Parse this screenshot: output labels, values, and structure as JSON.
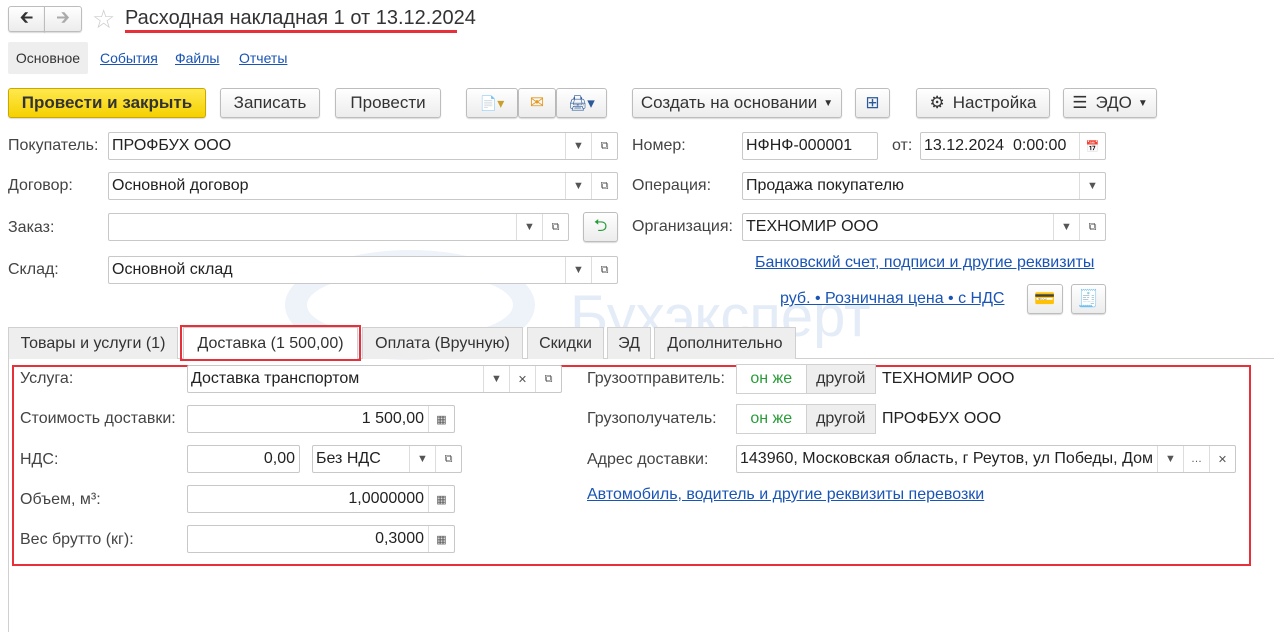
{
  "title": "Расходная накладная 1 от 13.12.2024",
  "nav_tabs": [
    "Основное",
    "События",
    "Файлы",
    "Отчеты"
  ],
  "toolbar": {
    "post_close": "Провести и закрыть",
    "save": "Записать",
    "post": "Провести",
    "create_based": "Создать на основании",
    "settings": "Настройка",
    "edo": "ЭДО"
  },
  "fields": {
    "buyer": {
      "label": "Покупатель:",
      "value": "ПРОФБУХ ООО"
    },
    "contract": {
      "label": "Договор:",
      "value": "Основной договор"
    },
    "order": {
      "label": "Заказ:",
      "value": ""
    },
    "warehouse": {
      "label": "Склад:",
      "value": "Основной склад"
    },
    "number": {
      "label": "Номер:",
      "value": "НФНФ-000001"
    },
    "date": {
      "label": "от:",
      "value": "13.12.2024  0:00:00"
    },
    "operation": {
      "label": "Операция:",
      "value": "Продажа покупателю"
    },
    "organization": {
      "label": "Организация:",
      "value": "ТЕХНОМИР ООО"
    }
  },
  "links": {
    "bank": "Банковский счет, подписи и другие реквизиты",
    "price": "руб. • Розничная цена • с НДС",
    "transport": "Автомобиль, водитель и другие реквизиты перевозки"
  },
  "watermark": "Бухэксперт",
  "doc_tabs": [
    "Товары и услуги (1)",
    "Доставка (1 500,00)",
    "Оплата (Вручную)",
    "Скидки",
    "ЭД",
    "Дополнительно"
  ],
  "delivery": {
    "service": {
      "label": "Услуга:",
      "value": "Доставка транспортом"
    },
    "cost": {
      "label": "Стоимость доставки:",
      "value": "1 500,00"
    },
    "vat": {
      "label": "НДС:",
      "value": "0,00",
      "rate": "Без НДС"
    },
    "volume": {
      "label": "Объем, м³:",
      "value": "1,0000000"
    },
    "weight": {
      "label": "Вес брутто (кг):",
      "value": "0,3000"
    },
    "shipper": {
      "label": "Грузоотправитель:",
      "same": "он же",
      "other": "другой",
      "value": "ТЕХНОМИР ООО"
    },
    "consignee": {
      "label": "Грузополучатель:",
      "same": "он же",
      "other": "другой",
      "value": "ПРОФБУХ ООО"
    },
    "address": {
      "label": "Адрес доставки:",
      "value": "143960, Московская область, г Реутов, ул Победы, Дом"
    }
  },
  "colors": {
    "accent_red": "#e8303a",
    "link": "#1a55b5",
    "green": "#2a9d3a"
  }
}
